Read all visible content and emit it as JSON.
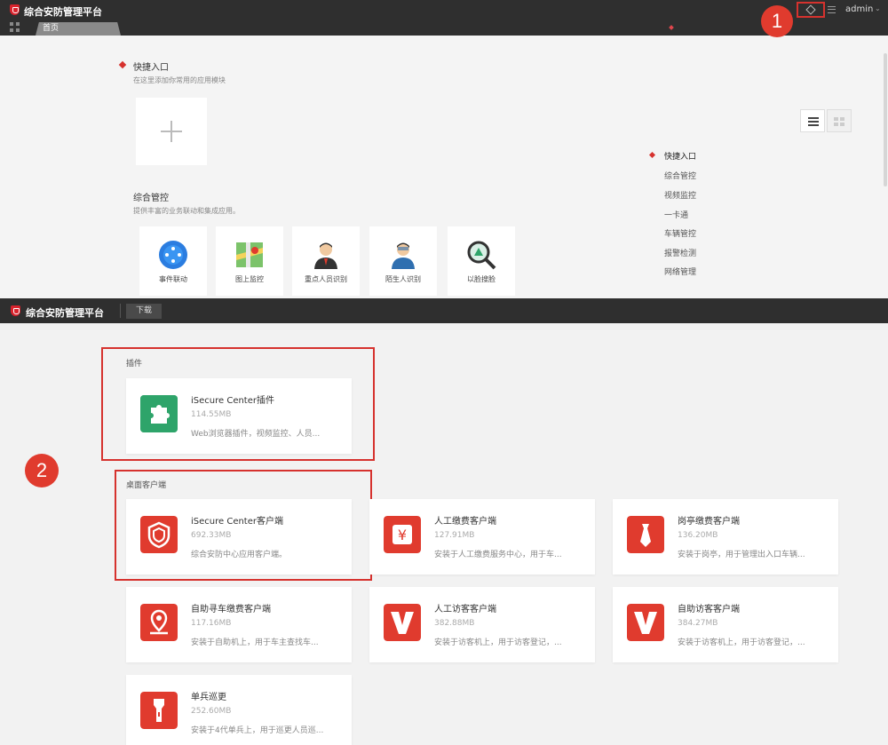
{
  "top_window": {
    "app_title": "综合安防管理平台",
    "tab_home": "首页",
    "user": "admin",
    "callout_1": "1",
    "quick_entry": {
      "title": "快捷入口",
      "subtitle": "在这里添加你常用的应用模块"
    },
    "integrated": {
      "title": "综合管控",
      "subtitle": "提供丰富的业务联动和集成应用。"
    },
    "modules": [
      {
        "label": "事件联动",
        "icon": "globe-icon"
      },
      {
        "label": "图上监控",
        "icon": "map-icon"
      },
      {
        "label": "重点人员识别",
        "icon": "person-icon"
      },
      {
        "label": "陌生人识别",
        "icon": "stranger-icon"
      },
      {
        "label": "以脸搜脸",
        "icon": "magnifier-icon"
      }
    ],
    "quick_nav": [
      "快捷入口",
      "综合管控",
      "视频监控",
      "一卡通",
      "车辆管控",
      "报警检测",
      "网络管理"
    ]
  },
  "bottom_window": {
    "app_title": "综合安防管理平台",
    "tab_download": "下载",
    "callout_2": "2",
    "plugin_group": {
      "title": "插件",
      "items": [
        {
          "name": "iSecure Center插件",
          "size": "114.55MB",
          "desc": "Web浏览器插件，视频监控、人员...",
          "icon": "puzzle-icon",
          "color": "#2ea46a"
        }
      ]
    },
    "client_group": {
      "title": "桌面客户端",
      "items": [
        {
          "name": "iSecure Center客户端",
          "size": "692.33MB",
          "desc": "综合安防中心应用客户端。",
          "icon": "shield-icon"
        },
        {
          "name": "人工缴费客户端",
          "size": "127.91MB",
          "desc": "安装于人工缴费服务中心，用于车...",
          "icon": "yen-icon"
        },
        {
          "name": "岗亭缴费客户端",
          "size": "136.20MB",
          "desc": "安装于岗亭，用于管理出入口车辆...",
          "icon": "tie-icon"
        },
        {
          "name": "自助寻车缴费客户端",
          "size": "117.16MB",
          "desc": "安装于自助机上，用于车主查找车...",
          "icon": "location-icon"
        },
        {
          "name": "人工访客客户端",
          "size": "382.88MB",
          "desc": "安装于访客机上，用于访客登记，...",
          "icon": "visitor-v-icon"
        },
        {
          "name": "自助访客客户端",
          "size": "384.27MB",
          "desc": "安装于访客机上，用于访客登记，...",
          "icon": "visitor-v-icon"
        },
        {
          "name": "单兵巡更",
          "size": "252.60MB",
          "desc": "安装于4代单兵上，用于巡更人员巡...",
          "icon": "flashlight-icon"
        }
      ]
    }
  },
  "colors": {
    "accent_red": "#e03b2e",
    "plugin_green": "#2ea46a",
    "header_dark": "#2f2f2f"
  }
}
